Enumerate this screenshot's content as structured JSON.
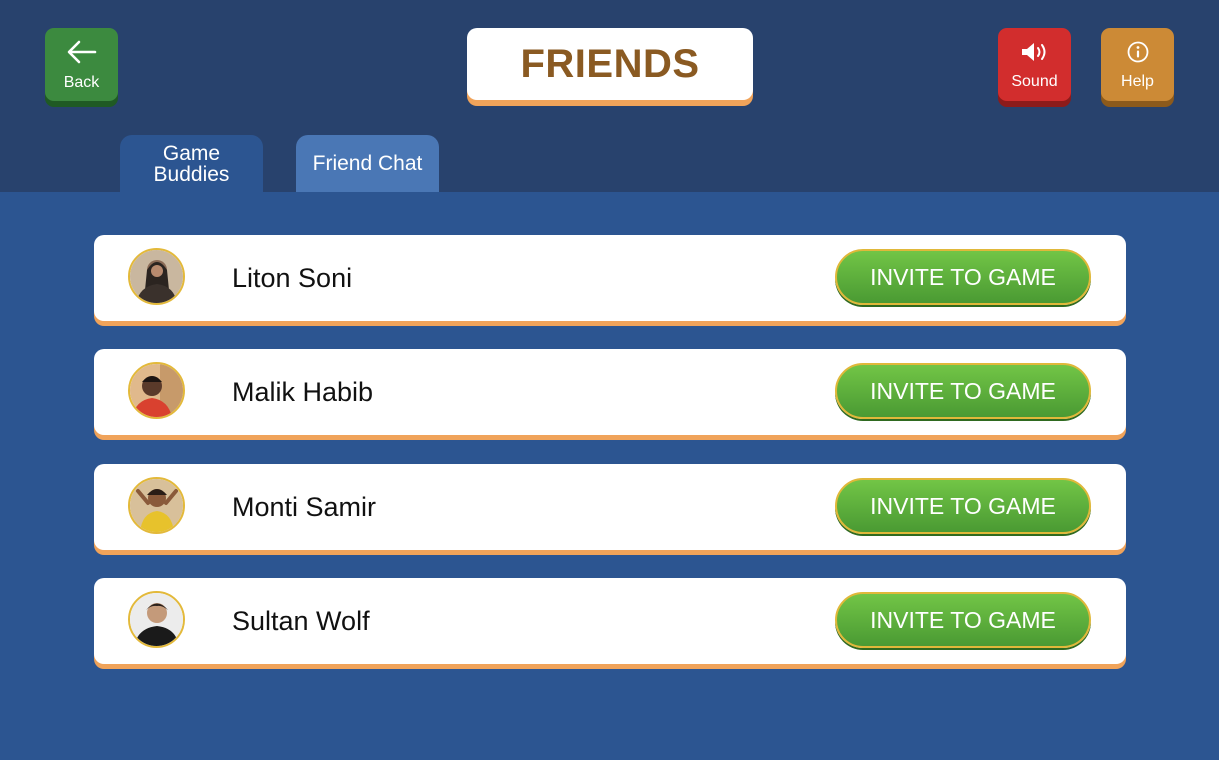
{
  "header": {
    "title": "FRIENDS",
    "back_label": "Back",
    "sound_label": "Sound",
    "help_label": "Help"
  },
  "tabs": [
    {
      "label": "Game Buddies",
      "active": true
    },
    {
      "label": "Friend Chat",
      "active": false
    }
  ],
  "friends": [
    {
      "name": "Liton Soni",
      "action": "INVITE TO GAME"
    },
    {
      "name": "Malik Habib",
      "action": "INVITE TO GAME"
    },
    {
      "name": "Monti Samir",
      "action": "INVITE TO GAME"
    },
    {
      "name": "Sultan Wolf",
      "action": "INVITE TO GAME"
    }
  ],
  "icons": {
    "back": "arrow-left-icon",
    "sound": "speaker-icon",
    "help": "info-icon"
  },
  "colors": {
    "background": "#2c5591",
    "header_bar": "#28426d",
    "back_button": "#3c8a3f",
    "sound_button": "#d22d2d",
    "help_button": "#cc8a36",
    "title_text": "#8a5a22",
    "accent_underline": "#f0a35a",
    "invite_button": "#5aaf3c"
  }
}
